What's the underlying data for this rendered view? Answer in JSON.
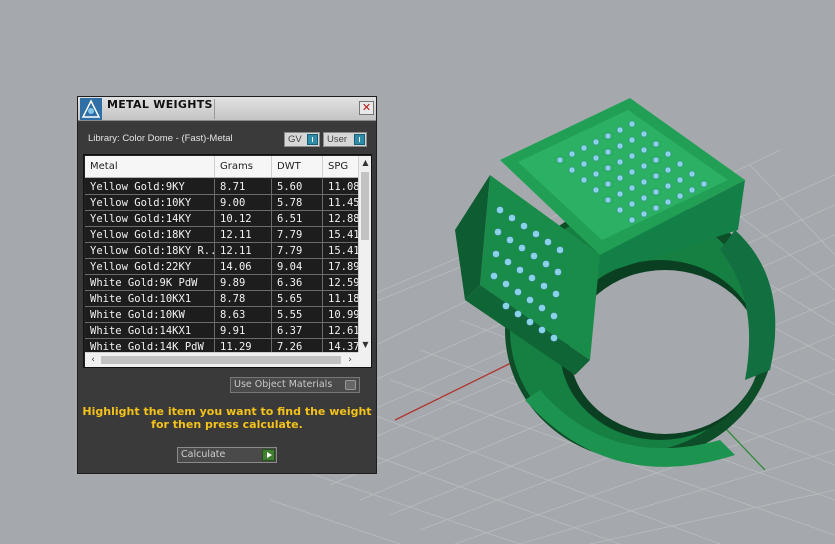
{
  "window": {
    "title": "METAL WEIGHTS",
    "close_glyph": "✕"
  },
  "library": {
    "label": "Library: Color Dome - (Fast)-Metal"
  },
  "toggles": [
    {
      "label": "GV"
    },
    {
      "label": "User"
    }
  ],
  "table": {
    "columns": [
      "Metal",
      "Grams",
      "DWT",
      "SPG"
    ],
    "rows": [
      {
        "metal": "Yellow Gold:9KY",
        "grams": "8.71",
        "dwt": "5.60",
        "spg": "11.08"
      },
      {
        "metal": "Yellow Gold:10KY",
        "grams": "9.00",
        "dwt": "5.78",
        "spg": "11.45"
      },
      {
        "metal": "Yellow Gold:14KY",
        "grams": "10.12",
        "dwt": "6.51",
        "spg": "12.88"
      },
      {
        "metal": "Yellow Gold:18KY",
        "grams": "12.11",
        "dwt": "7.79",
        "spg": "15.41"
      },
      {
        "metal": "Yellow Gold:18KY R...",
        "grams": "12.11",
        "dwt": "7.79",
        "spg": "15.41"
      },
      {
        "metal": "Yellow Gold:22KY",
        "grams": "14.06",
        "dwt": "9.04",
        "spg": "17.89"
      },
      {
        "metal": "White Gold:9K PdW",
        "grams": "9.89",
        "dwt": "6.36",
        "spg": "12.59"
      },
      {
        "metal": "White Gold:10KX1",
        "grams": "8.78",
        "dwt": "5.65",
        "spg": "11.18"
      },
      {
        "metal": "White Gold:10KW",
        "grams": "8.63",
        "dwt": "5.55",
        "spg": "10.99"
      },
      {
        "metal": "White Gold:14KX1",
        "grams": "9.91",
        "dwt": "6.37",
        "spg": "12.61"
      },
      {
        "metal": "White Gold:14K PdW",
        "grams": "11.29",
        "dwt": "7.26",
        "spg": "14.37"
      }
    ]
  },
  "use_object_materials": {
    "label": "Use Object Materials"
  },
  "help_text": {
    "line1": "Highlight the item you want to find the weight",
    "line2": "for then press calculate."
  },
  "calculate": {
    "label": "Calculate"
  },
  "colors": {
    "ring": "#1f8a4c",
    "ring_dark": "#0e5a2e",
    "gem": "#8ad2e8",
    "help": "#f4c21a",
    "background": "#a5a9ad"
  },
  "icons": [
    "app-logo-icon",
    "close-icon",
    "toggle-knob-icon",
    "play-icon",
    "scroll-up-icon",
    "scroll-down-icon",
    "scroll-left-icon",
    "scroll-right-icon"
  ]
}
